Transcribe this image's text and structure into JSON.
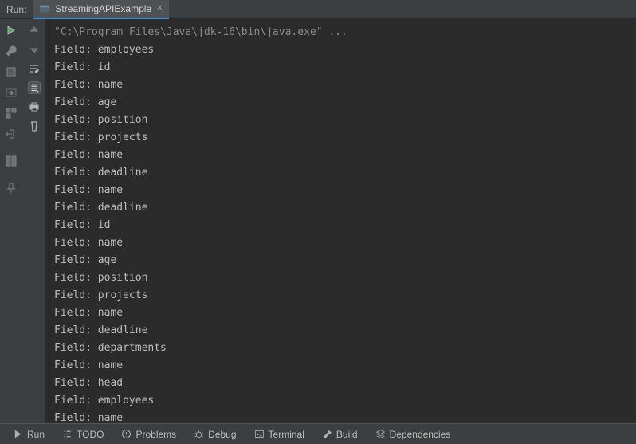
{
  "header": {
    "run_label": "Run:",
    "tab": {
      "label": "StreamingAPIExample"
    }
  },
  "console": {
    "cmd": "\"C:\\Program Files\\Java\\jdk-16\\bin\\java.exe\" ...",
    "lines": [
      "Field: employees",
      "Field: id",
      "Field: name",
      "Field: age",
      "Field: position",
      "Field: projects",
      "Field: name",
      "Field: deadline",
      "Field: name",
      "Field: deadline",
      "Field: id",
      "Field: name",
      "Field: age",
      "Field: position",
      "Field: projects",
      "Field: name",
      "Field: deadline",
      "Field: departments",
      "Field: name",
      "Field: head",
      "Field: employees",
      "Field: name"
    ]
  },
  "bottom": {
    "run": "Run",
    "todo": "TODO",
    "problems": "Problems",
    "debug": "Debug",
    "terminal": "Terminal",
    "build": "Build",
    "dependencies": "Dependencies"
  }
}
